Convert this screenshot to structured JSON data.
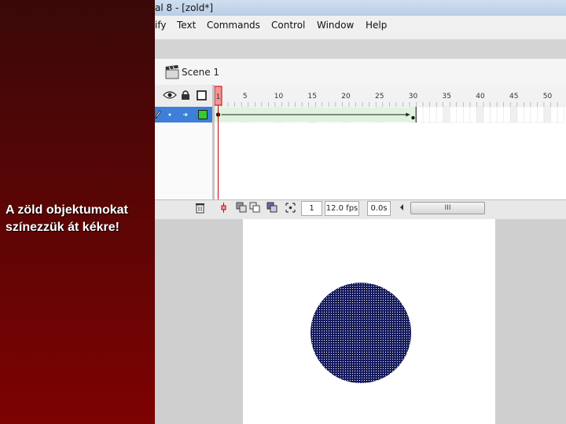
{
  "slide": {
    "caption_line1": "A zöld objektumokat",
    "caption_line2": "színezzük át kékre!",
    "sidebar_colors": [
      "#3a0808",
      "#7e0202"
    ]
  },
  "window": {
    "title": "al 8 - [zold*]"
  },
  "menu": {
    "items": [
      "ify",
      "Text",
      "Commands",
      "Control",
      "Window",
      "Help"
    ]
  },
  "edit_bar": {
    "scene_label": "Scene 1"
  },
  "timeline": {
    "frame_ruler": [
      "1",
      "5",
      "10",
      "15",
      "20",
      "25",
      "30",
      "35",
      "40",
      "45",
      "50"
    ],
    "current_frame": "1",
    "frame_rate": "12.0 fps",
    "elapsed_time": "0.0s",
    "tween_end_frame": 30,
    "scrollbar_grip": "III",
    "playhead_color": "#cc0000",
    "tween_color": "#dff3df",
    "selected_layer_color": "#3d7fd9",
    "layer_color_swatch": "#33cc33"
  },
  "stage": {
    "shape": "circle",
    "shape_fill": "#151a5c",
    "shape_state": "selected (dotted)"
  }
}
